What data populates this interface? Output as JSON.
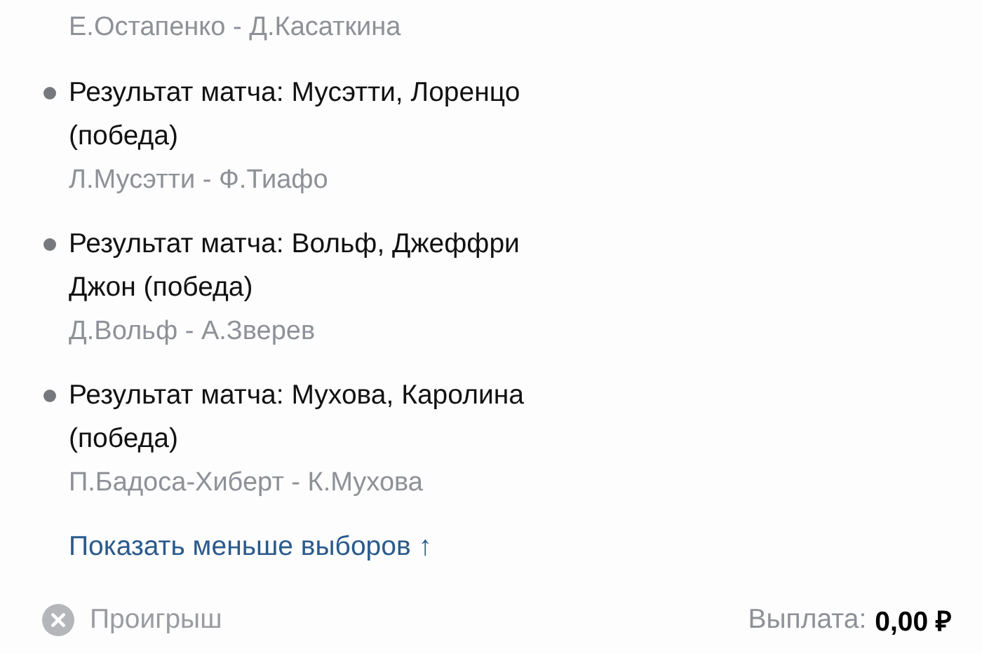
{
  "partial_top": {
    "players": "Е.Остапенко - Д.Касаткина"
  },
  "selections": [
    {
      "title": "Результат матча: Мусэтти, Лоренцо (победа)",
      "players": "Л.Мусэтти - Ф.Тиафо"
    },
    {
      "title": "Результат матча: Вольф, Джеффри Джон (победа)",
      "players": "Д.Вольф - А.Зверев"
    },
    {
      "title": "Результат матча: Мухова, Каролина (победа)",
      "players": "П.Бадоса-Хиберт - К.Мухова"
    }
  ],
  "toggle_link": "Показать меньше выборов ↑",
  "footer": {
    "status": "Проигрыш",
    "payout_label": "Выплата:",
    "payout_value": "0,00 ₽"
  }
}
